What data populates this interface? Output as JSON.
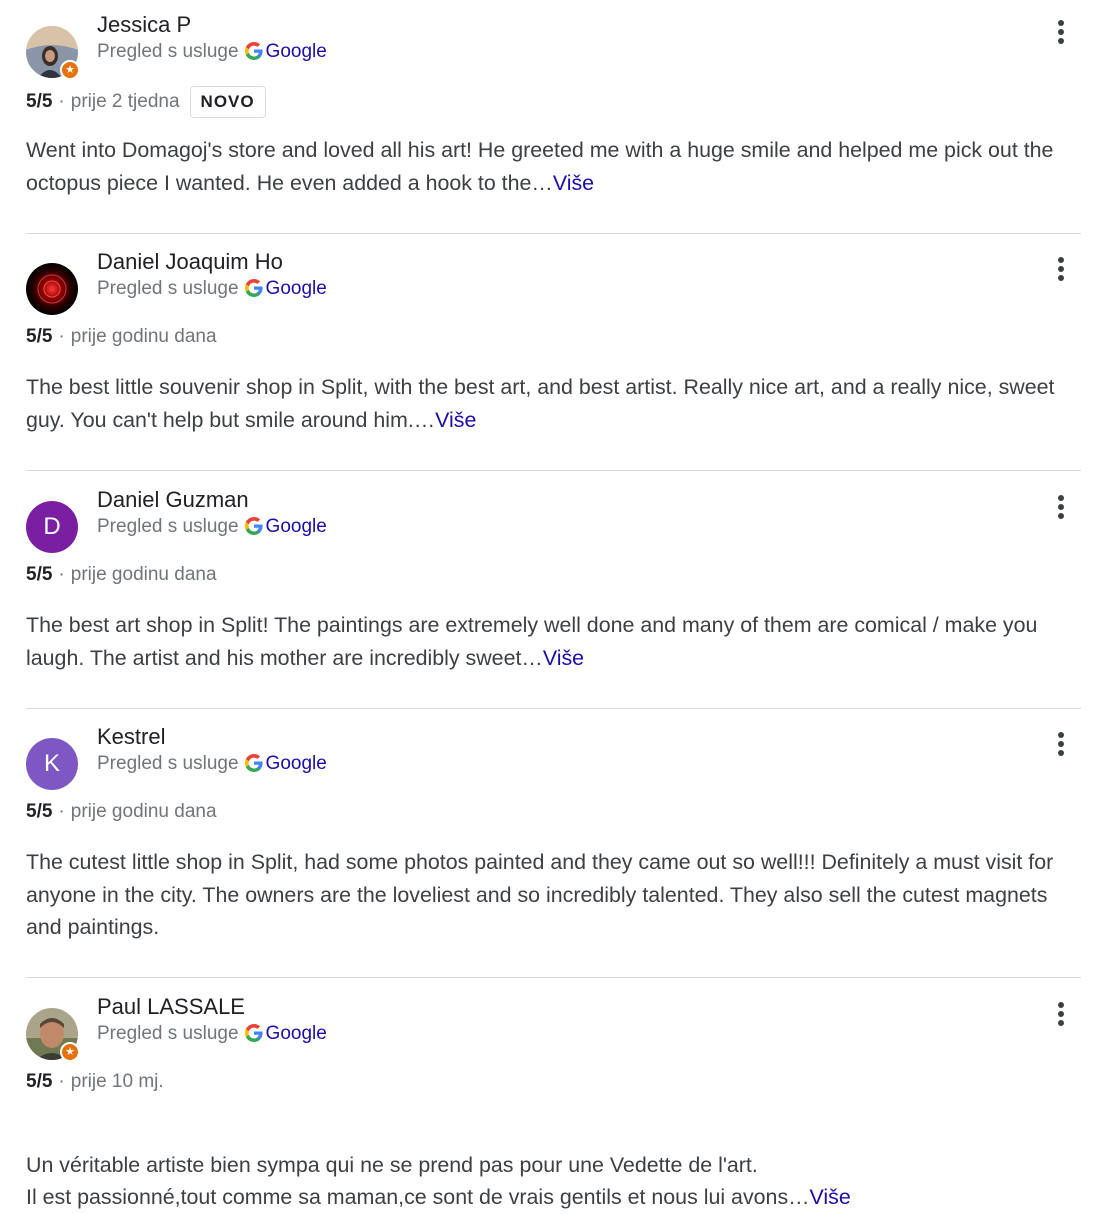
{
  "colors": {
    "link": "#1a0dab",
    "muted": "#70757a",
    "text": "#3c4043",
    "divider": "#dadce0",
    "local_guide_badge": "#e8710a"
  },
  "icons": {
    "more": "more-vert-icon",
    "google": "google-g-icon",
    "local_guide": "local-guide-star-icon"
  },
  "reviews": [
    {
      "author": "Jessica P",
      "source_prefix": "Pregled s usluge",
      "source_brand": "Google",
      "rating": "5/5",
      "separator": "·",
      "time": "prije 2 tjedna",
      "badge": "NOVO",
      "text": "Went into Domagoj's store and loved all his art! He greeted me with a huge smile and helped me pick out the octopus piece I wanted. He even added a hook to the…",
      "more_label": "Više",
      "avatar_type": "photo",
      "local_guide": true
    },
    {
      "author": "Daniel Joaquim Ho",
      "source_prefix": "Pregled s usluge",
      "source_brand": "Google",
      "rating": "5/5",
      "separator": "·",
      "time": "prije godinu dana",
      "text": "The best little souvenir shop in Split, with the best art, and best artist. Really nice art, and a really nice, sweet guy. You can't help but smile around him.…",
      "more_label": "Više",
      "avatar_type": "photo",
      "local_guide": false
    },
    {
      "author": "Daniel Guzman",
      "source_prefix": "Pregled s usluge",
      "source_brand": "Google",
      "rating": "5/5",
      "separator": "·",
      "time": "prije godinu dana",
      "text": "The best art shop in Split! The paintings are extremely well done and many of them are comical / make you laugh. The artist and his mother are incredibly sweet…",
      "more_label": "Više",
      "avatar_type": "letter",
      "avatar_letter": "D",
      "avatar_color": "#7b1fa2",
      "local_guide": false
    },
    {
      "author": "Kestrel",
      "source_prefix": "Pregled s usluge",
      "source_brand": "Google",
      "rating": "5/5",
      "separator": "·",
      "time": "prije godinu dana",
      "text": "The cutest little shop in Split, had some photos painted and they came out so well!!! Definitely a must visit for anyone in the city. The owners are the loveliest and so incredibly talented. They also sell the cutest magnets and paintings.",
      "more_label": "",
      "avatar_type": "letter",
      "avatar_letter": "K",
      "avatar_color": "#7e57c2",
      "local_guide": false
    },
    {
      "author": "Paul LASSALE",
      "source_prefix": "Pregled s usluge",
      "source_brand": "Google",
      "rating": "5/5",
      "separator": "·",
      "time": "prije 10 mj.",
      "text": "Un véritable artiste bien sympa qui ne se prend pas pour une Vedette de l'art.\nIl est passionné,tout comme sa maman,ce sont de vrais gentils et nous lui avons…",
      "more_label": "Više",
      "avatar_type": "photo",
      "local_guide": true
    }
  ]
}
